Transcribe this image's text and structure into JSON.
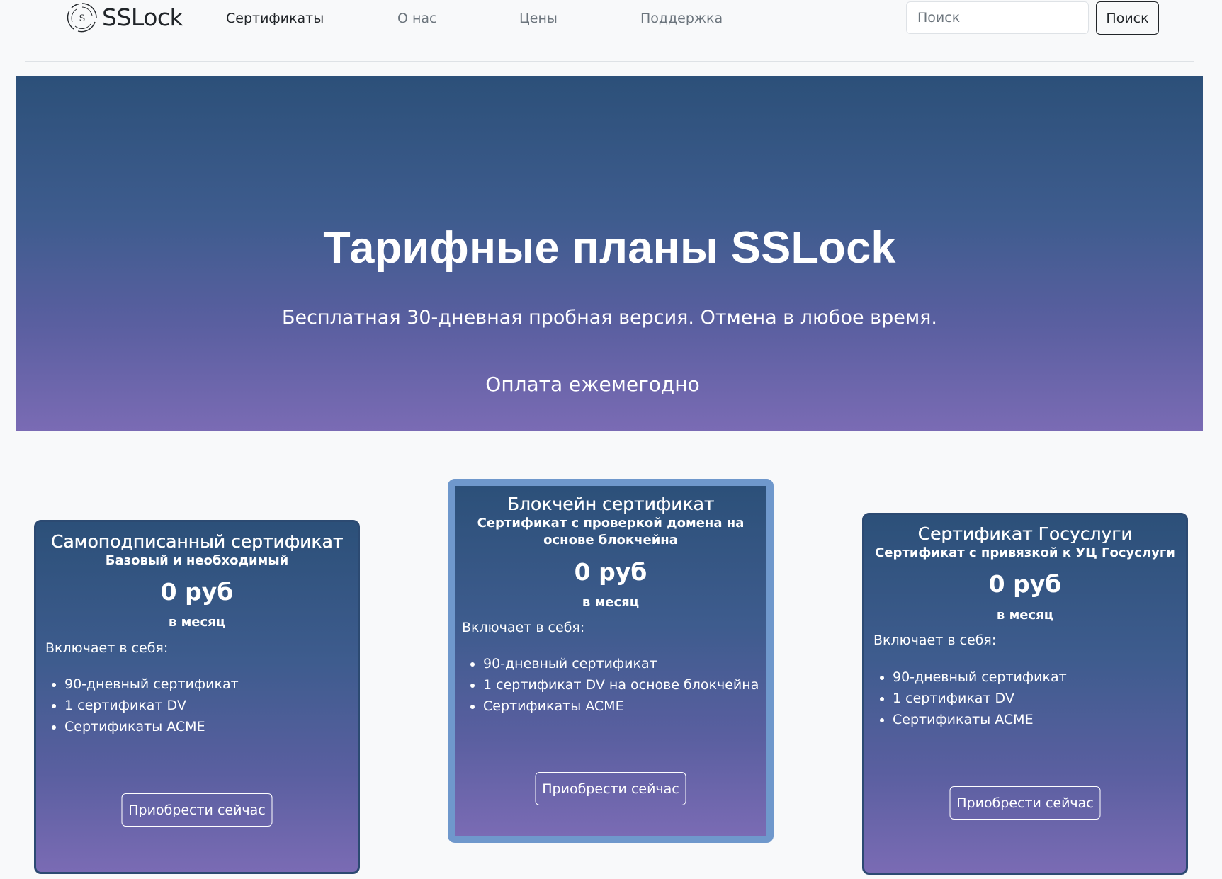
{
  "navbar": {
    "brand": "SSLock",
    "logo_letter": "S",
    "links": [
      {
        "label": "Сертификаты",
        "active": true
      },
      {
        "label": "О нас",
        "active": false
      },
      {
        "label": "Цены",
        "active": false
      },
      {
        "label": "Поддержка",
        "active": false
      }
    ],
    "search": {
      "placeholder": "Поиск",
      "value": "",
      "button_label": "Поиск"
    }
  },
  "hero": {
    "title": "Тарифные планы SSLock",
    "subtitle": "Бесплатная 30-дневная пробная версия. Отмена в любое время.",
    "billing": "Оплата ежемегодно"
  },
  "plans": [
    {
      "title": "Самоподписанный сертификат",
      "subtitle": "Базовый и необходимый",
      "price": "0 руб",
      "period": "в месяц",
      "includes_label": "Включает в себя:",
      "features": [
        "90-дневный сертификат",
        "1 сертификат DV",
        "Сертификаты ACME"
      ],
      "button_label": "Приобрести сейчас",
      "highlighted": false
    },
    {
      "title": "Блокчейн сертификат",
      "subtitle": "Сертификат с проверкой домена на основе блокчейна",
      "price": "0 руб",
      "period": "в месяц",
      "includes_label": "Включает в себя:",
      "features": [
        "90-дневный сертификат",
        "1 сертификат DV на основе блокчейна",
        "Сертификаты ACME"
      ],
      "button_label": "Приобрести сейчас",
      "highlighted": true
    },
    {
      "title": "Сертификат Госуслуги",
      "subtitle": "Сертификат с привязкой к УЦ Госуслуги",
      "price": "0 руб",
      "period": "в месяц",
      "includes_label": "Включает в себя:",
      "features": [
        "90-дневный сертификат",
        "1 сертификат DV",
        "Сертификаты ACME"
      ],
      "button_label": "Приобрести сейчас",
      "highlighted": false
    }
  ],
  "colors": {
    "gradient_top": "#2c5079",
    "gradient_bottom": "#7a6bb4",
    "highlight_border": "#6f98cc",
    "page_background": "#f8f9fa"
  }
}
